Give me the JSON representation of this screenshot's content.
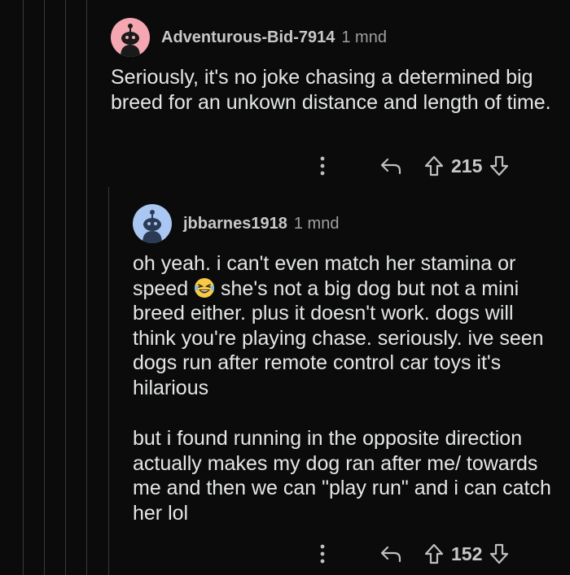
{
  "comments": [
    {
      "username": "Adventurous-Bid-7914",
      "time": "1 mnd",
      "avatar_color": "#f4a7b0",
      "body": "Seriously, it's no joke chasing a determined big breed for an unkown distance and length of time.",
      "score": "215",
      "more_icon": "more-vertical-icon",
      "reply_icon": "reply-arrow-icon"
    },
    {
      "username": "jbbarnes1918",
      "time": "1 mnd",
      "avatar_color": "#a9c7f2",
      "body_part1": "oh yeah. i can't even match her stamina or speed",
      "emoji": "laughing-face-icon",
      "body_part2": " she's not a big dog but not a mini breed either. plus it doesn't work. dogs will think you're playing chase. seriously. ive seen dogs run after remote control car toys it's hilarious",
      "body_paragraph2": "but i found running in the opposite direction actually makes my dog ran after me/ towards me and then we can \"play run\" and i can catch her lol",
      "score": "152",
      "more_icon": "more-vertical-icon",
      "reply_icon": "reply-arrow-icon"
    }
  ],
  "colors": {
    "background": "#0b0b0b",
    "thread_line": "#3a3a3a",
    "text": "#e4e6e8"
  }
}
